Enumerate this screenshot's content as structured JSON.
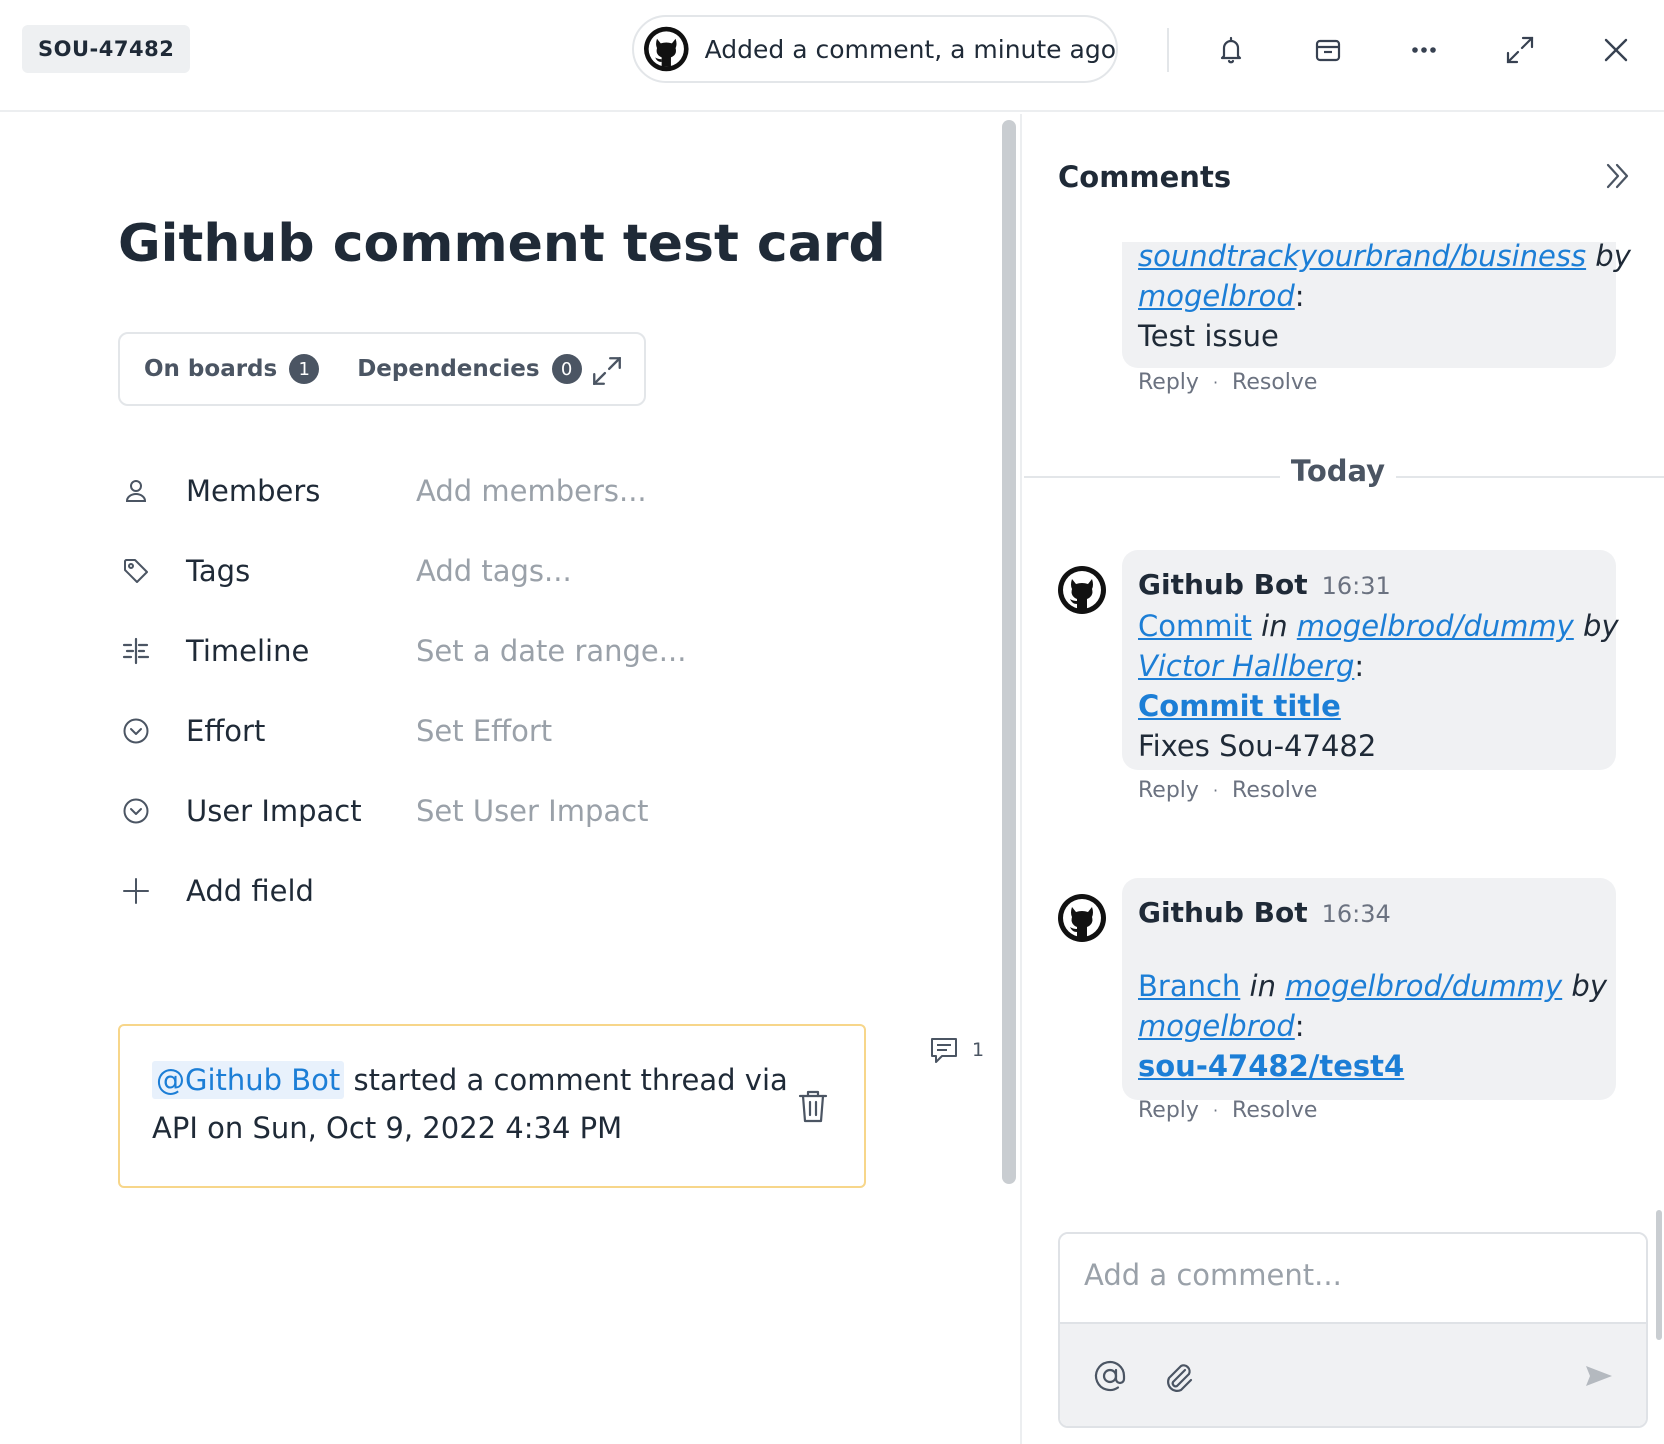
{
  "header": {
    "card_id": "SOU-47482",
    "activity": "Added a comment, a minute ago",
    "icons": [
      "bell-icon",
      "archive-icon",
      "more-icon",
      "expand-icon",
      "close-icon"
    ]
  },
  "card": {
    "title": "Github comment test card",
    "chips": [
      {
        "label": "On boards",
        "count": "1"
      },
      {
        "label": "Dependencies",
        "count": "0"
      }
    ],
    "fields": [
      {
        "label": "Members",
        "value": "Add members..."
      },
      {
        "label": "Tags",
        "value": "Add tags..."
      },
      {
        "label": "Timeline",
        "value": "Set a date range..."
      },
      {
        "label": "Effort",
        "value": "Set Effort"
      },
      {
        "label": "User Impact",
        "value": "Set User Impact"
      },
      {
        "label": "Add field",
        "value": ""
      }
    ],
    "thread": {
      "mention": "@Github Bot",
      "text": " started a comment thread via API on Sun, Oct 9, 2022 4:34 PM",
      "comment_count": "1"
    }
  },
  "comments": {
    "title": "Comments",
    "divider": "Today",
    "earlier": {
      "repo": "soundtrackyourbrand/business",
      "by": " by",
      "author": "mogelbrod",
      "colon": ":",
      "body": "Test issue"
    },
    "items": [
      {
        "author": "Github Bot",
        "time": "16:31",
        "kind": "Commit",
        "in": " in ",
        "repo": "mogelbrod/dummy",
        "by": " by",
        "user": "Victor Hallberg",
        "colon": ":",
        "title": "Commit title",
        "body": "Fixes Sou-47482"
      },
      {
        "author": "Github Bot",
        "time": "16:34",
        "kind": "Branch",
        "in": " in ",
        "repo": "mogelbrod/dummy",
        "by": " by",
        "user": "mogelbrod",
        "colon": ":",
        "title": "sou-47482/test4"
      }
    ],
    "actions": {
      "reply": "Reply",
      "separator": "·",
      "resolve": "Resolve"
    },
    "composer_placeholder": "Add a comment..."
  },
  "colors": {
    "link": "#1c7ed6",
    "thread_border": "#f7d68a",
    "bubble_bg": "#f0f1f3"
  }
}
